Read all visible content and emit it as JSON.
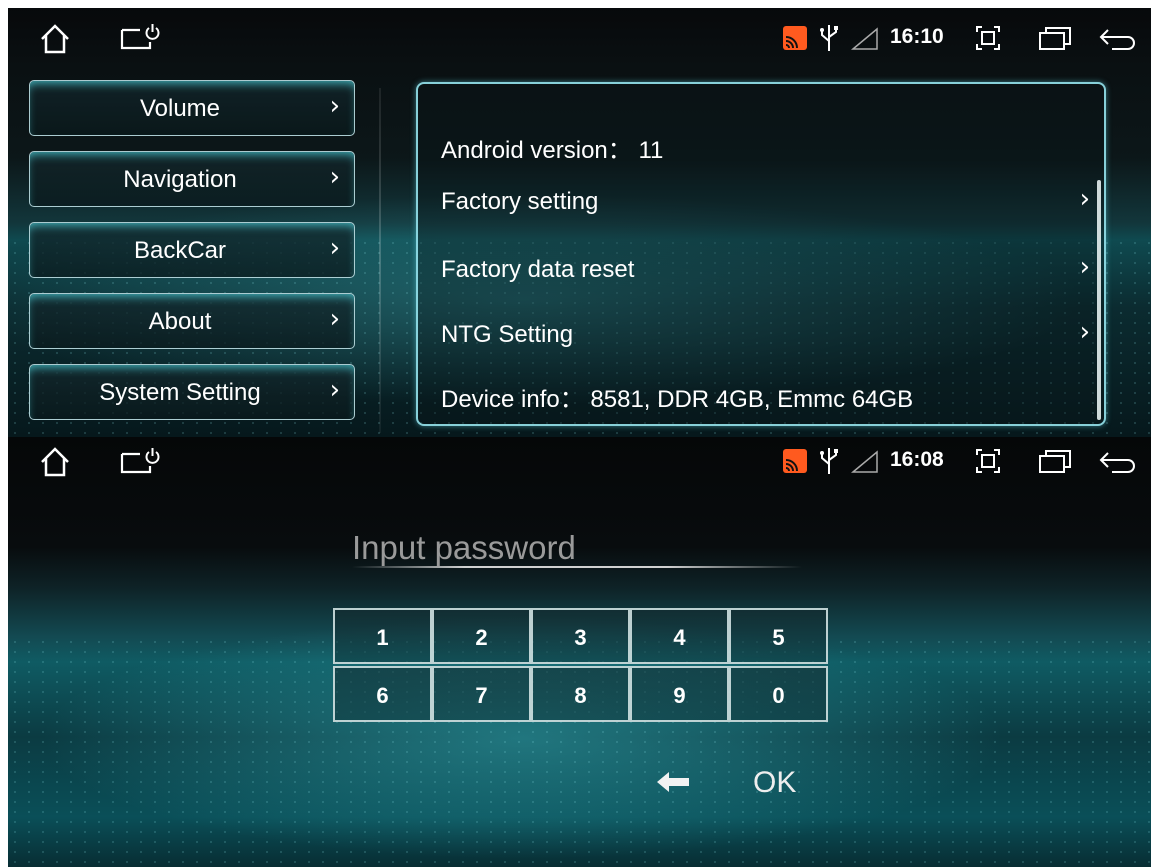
{
  "top_screen": {
    "status_bar": {
      "time": "16:10",
      "left_icons": [
        "home-icon",
        "power-display-icon"
      ],
      "right_icons": [
        "cast-icon",
        "usb-icon",
        "signal-icon",
        "screenshot-icon",
        "recent-apps-icon",
        "back-icon"
      ]
    },
    "menu": {
      "items": [
        {
          "label": "Volume"
        },
        {
          "label": "Navigation"
        },
        {
          "label": "BackCar"
        },
        {
          "label": "About"
        },
        {
          "label": "System Setting"
        }
      ],
      "chevron": "›"
    },
    "about_panel": {
      "android_version_label": "Android version：",
      "android_version_value": "11",
      "rows": [
        {
          "label": "Factory setting"
        },
        {
          "label": "Factory data reset"
        },
        {
          "label": "NTG Setting"
        }
      ],
      "device_info_label": "Device info：",
      "device_info_value": "8581, DDR 4GB, Emmc 64GB",
      "chevron": "›"
    }
  },
  "bottom_screen": {
    "status_bar": {
      "time": "16:08",
      "left_icons": [
        "home-icon",
        "power-display-icon"
      ],
      "right_icons": [
        "cast-icon",
        "usb-icon",
        "signal-icon",
        "screenshot-icon",
        "recent-apps-icon",
        "back-icon"
      ]
    },
    "password": {
      "placeholder": "Input password",
      "value": ""
    },
    "keypad": {
      "rows": [
        [
          "1",
          "2",
          "3",
          "4",
          "5"
        ],
        [
          "6",
          "7",
          "8",
          "9",
          "0"
        ]
      ]
    },
    "actions": {
      "backspace_icon": "backspace-arrow-icon",
      "ok_label": "OK"
    }
  },
  "colors": {
    "accent_teal": "#3fc3cc",
    "cast_orange": "#ff5a1f",
    "text": "#ffffff"
  }
}
